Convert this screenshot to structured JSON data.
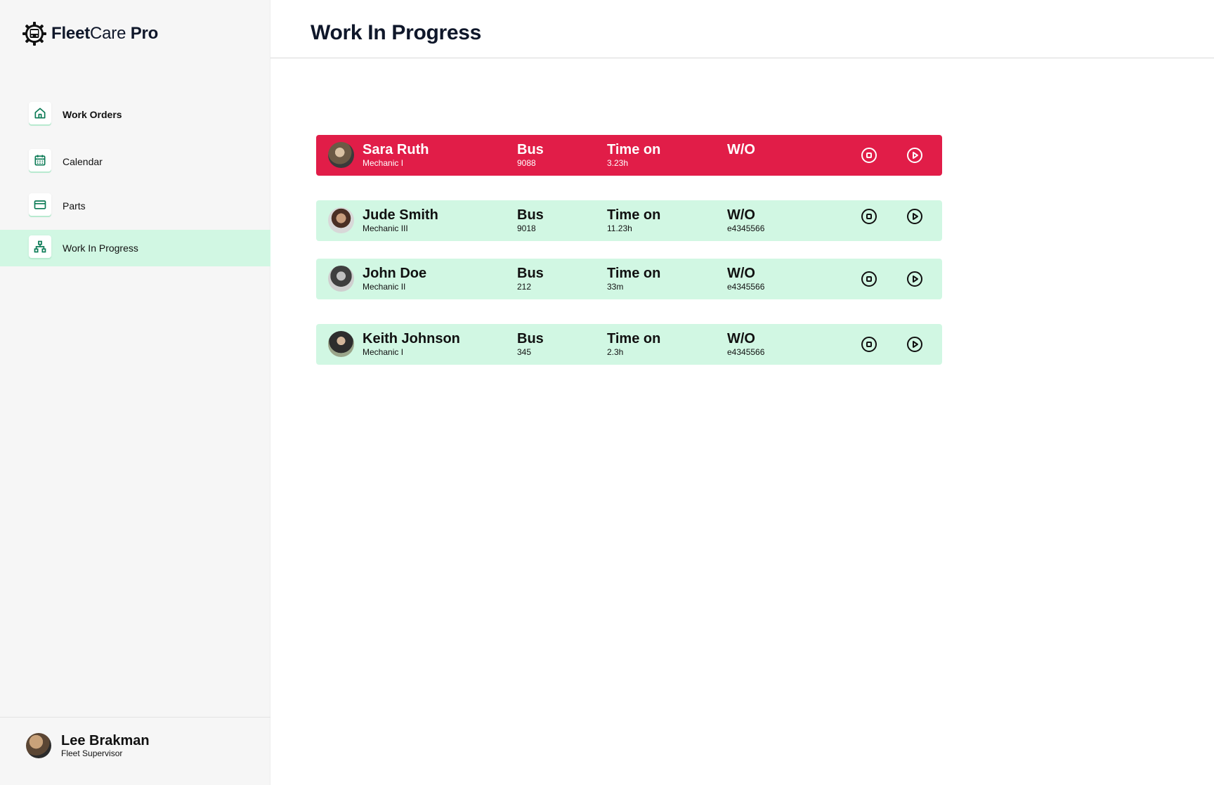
{
  "brand": {
    "part1": "Fleet",
    "part2": "Care",
    "part3": " Pro"
  },
  "sidebar": {
    "items": [
      {
        "label": "Work Orders",
        "icon": "home-icon",
        "active": false
      },
      {
        "label": "Calendar",
        "icon": "calendar-icon",
        "active": false
      },
      {
        "label": "Parts",
        "icon": "credit-card-icon",
        "active": false
      },
      {
        "label": "Work In Progress",
        "icon": "sitemap-icon",
        "active": true
      }
    ]
  },
  "user": {
    "name": "Lee Brakman",
    "role": "Fleet Supervisor"
  },
  "header": {
    "title": "Work In Progress"
  },
  "labels": {
    "bus": "Bus",
    "time_on": "Time on",
    "wo": "W/O"
  },
  "rows": [
    {
      "name": "Sara Ruth",
      "role": "Mechanic I",
      "bus": "9088",
      "time_on": "3.23h",
      "wo": "",
      "status": "alert"
    },
    {
      "name": "Jude Smith",
      "role": "Mechanic III",
      "bus": "9018",
      "time_on": "11.23h",
      "wo": "e4345566",
      "status": "normal"
    },
    {
      "name": "John Doe",
      "role": "Mechanic II",
      "bus": "212",
      "time_on": "33m",
      "wo": "e4345566",
      "status": "normal"
    },
    {
      "name": "Keith Johnson",
      "role": "Mechanic I",
      "bus": "345",
      "time_on": "2.3h",
      "wo": "e4345566",
      "status": "normal"
    }
  ],
  "colors": {
    "alert_row": "#e11d48",
    "normal_row": "#d1f7e3",
    "active_nav": "#d1f7e3",
    "nav_icon": "#0b7a55",
    "sidebar_bg": "#f6f6f6"
  }
}
